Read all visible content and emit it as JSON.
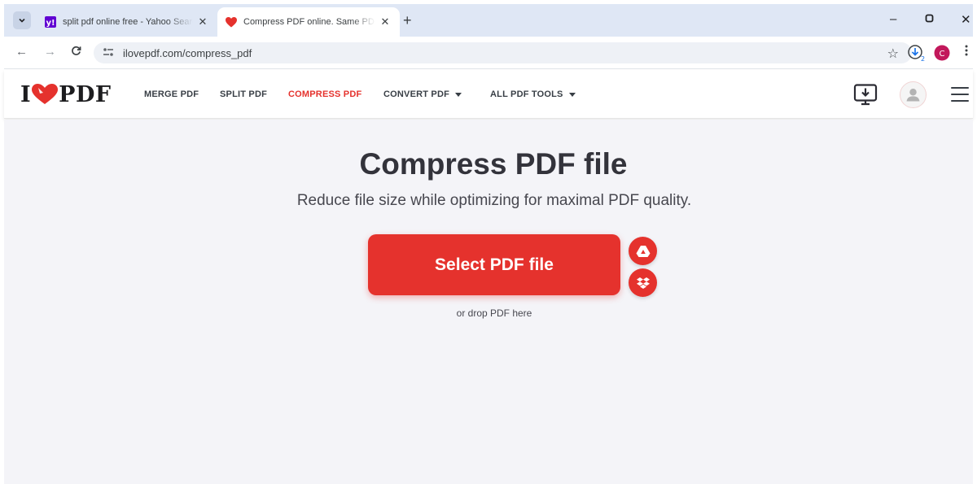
{
  "browser": {
    "tabs": [
      {
        "title": "split pdf online free - Yahoo Search",
        "active": false,
        "favicon": "yahoo-icon"
      },
      {
        "title": "Compress PDF online. Same PDF quality, less file size",
        "active": true,
        "favicon": "ilovepdf-heart-icon"
      }
    ],
    "url": "ilovepdf.com/compress_pdf",
    "profile_initial": "C",
    "download_count": "2"
  },
  "site": {
    "logo": {
      "left": "I",
      "right": "PDF"
    },
    "nav": [
      {
        "label": "MERGE PDF",
        "active": false,
        "dropdown": false
      },
      {
        "label": "SPLIT PDF",
        "active": false,
        "dropdown": false
      },
      {
        "label": "COMPRESS PDF",
        "active": true,
        "dropdown": false
      },
      {
        "label": "CONVERT PDF",
        "active": false,
        "dropdown": true
      },
      {
        "label": "ALL PDF TOOLS",
        "active": false,
        "dropdown": true
      }
    ]
  },
  "main": {
    "title": "Compress PDF file",
    "subtitle": "Reduce file size while optimizing for maximal PDF quality.",
    "select_button": "Select PDF file",
    "cloud_sources": [
      "google-drive-icon",
      "dropbox-icon"
    ],
    "drop_hint": "or drop PDF here"
  },
  "colors": {
    "accent": "#e5322d",
    "tabstrip": "#dfe7f5",
    "page_bg": "#f4f4f8"
  }
}
